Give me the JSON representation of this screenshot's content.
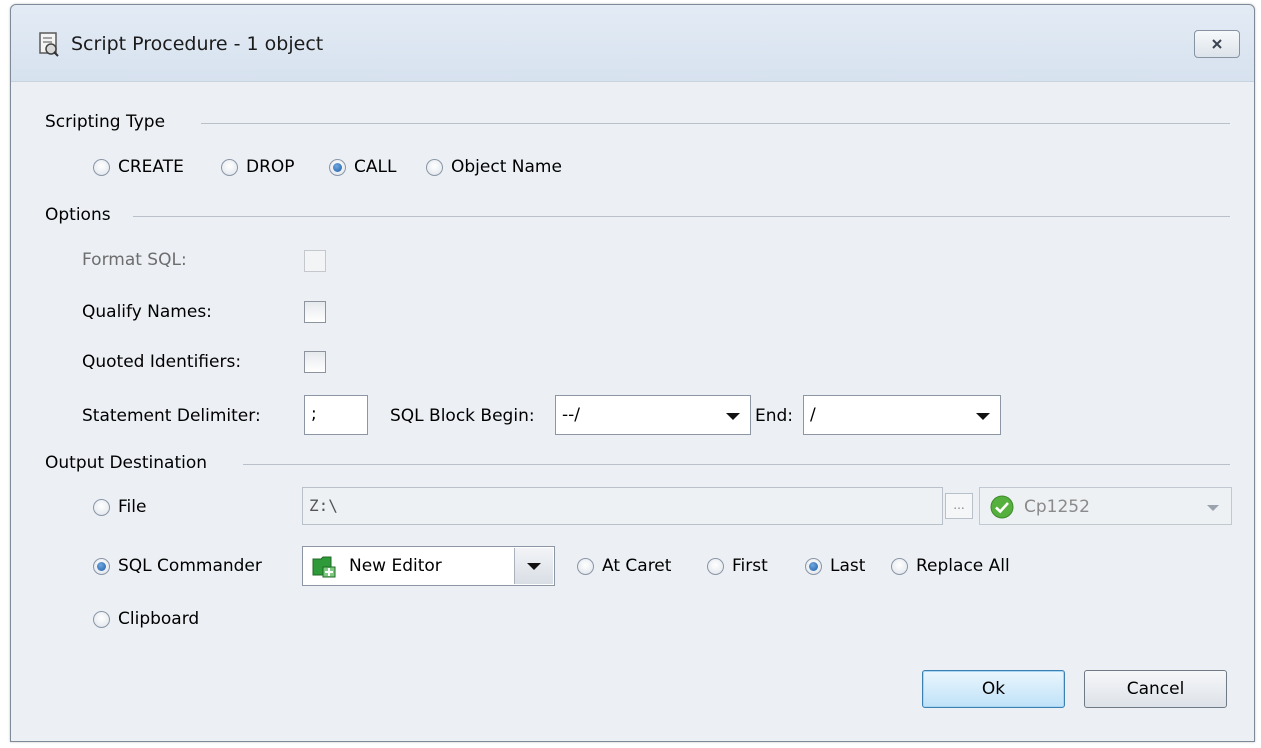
{
  "window": {
    "title": "Script Procedure - 1 object",
    "close_icon": "close-icon"
  },
  "scripting_type": {
    "label": "Scripting Type",
    "options": [
      {
        "label": "CREATE",
        "checked": false
      },
      {
        "label": "DROP",
        "checked": false
      },
      {
        "label": "CALL",
        "checked": true
      },
      {
        "label": "Object Name",
        "checked": false
      }
    ]
  },
  "options": {
    "label": "Options",
    "format_sql": {
      "label": "Format SQL:",
      "checked": false,
      "enabled": false
    },
    "qualify_names": {
      "label": "Qualify Names:",
      "checked": false
    },
    "quoted_identifiers": {
      "label": "Quoted Identifiers:",
      "checked": false
    },
    "statement_delimiter": {
      "label": "Statement Delimiter:",
      "value": ";"
    },
    "sql_block_begin": {
      "label": "SQL Block Begin:",
      "value": "--/"
    },
    "end": {
      "label": "End:",
      "value": "/"
    }
  },
  "output": {
    "label": "Output Destination",
    "file": {
      "label": "File",
      "checked": false,
      "path": "Z:\\",
      "browse_label": "...",
      "encoding": "Cp1252"
    },
    "sql_commander": {
      "label": "SQL Commander",
      "checked": true,
      "editor": "New Editor",
      "positions": [
        {
          "label": "At Caret",
          "checked": false
        },
        {
          "label": "First",
          "checked": false
        },
        {
          "label": "Last",
          "checked": true
        },
        {
          "label": "Replace All",
          "checked": false
        }
      ]
    },
    "clipboard": {
      "label": "Clipboard",
      "checked": false
    }
  },
  "buttons": {
    "ok": "Ok",
    "cancel": "Cancel"
  },
  "colors": {
    "dialog_bg": "#ecf0f5",
    "titlebar": "#dbe5f1",
    "accent": "#1e5fa8",
    "ok_button": "#bfe2f8"
  }
}
